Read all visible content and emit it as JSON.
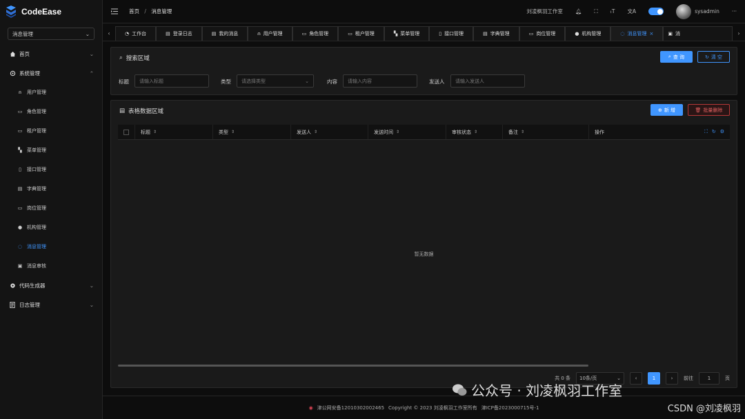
{
  "app": {
    "name": "CodeEase",
    "brand_color": "#4096ff"
  },
  "sidebar": {
    "selector": "消息管理",
    "items": [
      {
        "label": "首页",
        "icon": "home-icon"
      },
      {
        "label": "系统管理",
        "icon": "gear-icon"
      },
      {
        "label": "代码生成器",
        "icon": "gear-icon"
      },
      {
        "label": "日志管理",
        "icon": "document-icon"
      }
    ],
    "sub_items": [
      {
        "label": "用户管理",
        "icon": "user-icon"
      },
      {
        "label": "角色管理",
        "icon": "role-icon"
      },
      {
        "label": "租户管理",
        "icon": "tenant-icon"
      },
      {
        "label": "菜单管理",
        "icon": "grid-icon"
      },
      {
        "label": "接口管理",
        "icon": "api-icon"
      },
      {
        "label": "字典管理",
        "icon": "book-icon"
      },
      {
        "label": "岗位管理",
        "icon": "post-icon"
      },
      {
        "label": "机构管理",
        "icon": "org-icon"
      },
      {
        "label": "消息管理",
        "icon": "message-icon",
        "active": true
      },
      {
        "label": "消息审核",
        "icon": "clipboard-icon"
      }
    ]
  },
  "header": {
    "breadcrumb_home": "首页",
    "breadcrumb_sep": "/",
    "breadcrumb_current": "消息管理",
    "studio": "刘凌枫羽工作室",
    "username": "sysadmin"
  },
  "tabs": [
    "工作台",
    "登录日志",
    "我的消息",
    "用户管理",
    "角色管理",
    "租户管理",
    "菜单管理",
    "接口管理",
    "字典管理",
    "岗位管理",
    "机构管理",
    "消息管理",
    "消"
  ],
  "search": {
    "title": "搜索区域",
    "query_btn": "查 询",
    "clear_btn": "清 空",
    "fields": [
      {
        "label": "标题",
        "placeholder": "请输入标题"
      },
      {
        "label": "类型",
        "placeholder": "请选择类型"
      },
      {
        "label": "内容",
        "placeholder": "请输入内容"
      },
      {
        "label": "发送人",
        "placeholder": "请输入发送人"
      }
    ]
  },
  "table": {
    "title": "表格数据区域",
    "add_btn": "新 增",
    "batch_delete_btn": "批量删除",
    "columns": [
      "标题",
      "类型",
      "发送人",
      "发送时间",
      "审核状态",
      "备注",
      "操作"
    ],
    "empty_text": "暂无数据"
  },
  "pagination": {
    "total": "共 0 条",
    "page_size": "10条/页",
    "current": "1",
    "goto_label": "前往",
    "goto_value": "1",
    "page_suffix": "页"
  },
  "footer": {
    "police": "津公网安备12010302002465",
    "copyright": "Copyright © 2023 刘凌枫羽工作室所有",
    "icp": "津ICP备2023000715号-1"
  },
  "watermark": {
    "text": "公众号 · 刘凌枫羽工作室",
    "csdn": "CSDN @刘凌枫羽"
  }
}
